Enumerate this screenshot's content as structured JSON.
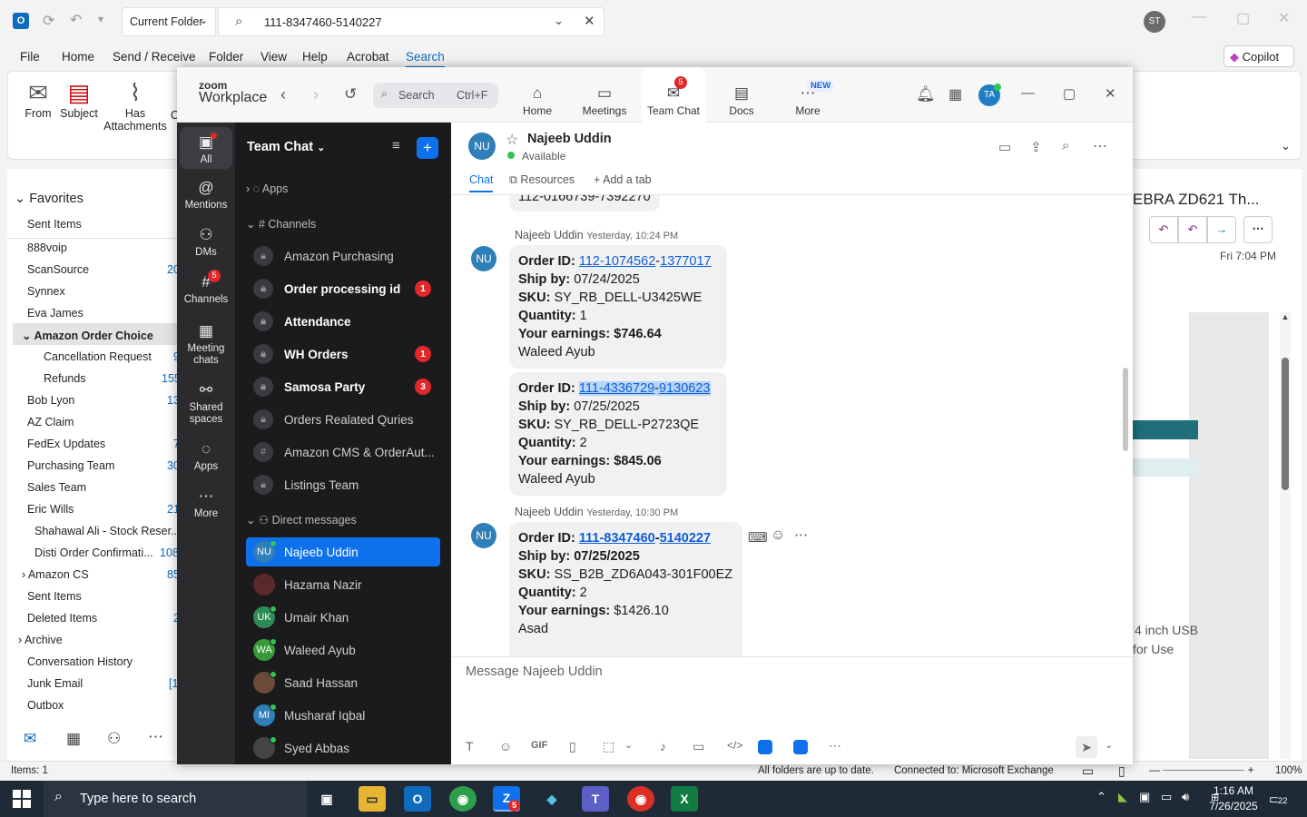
{
  "outlook": {
    "scope": "Current Folder",
    "search_value": "111-8347460-5140227",
    "user_initials": "ST",
    "tabs": [
      "File",
      "Home",
      "Send / Receive",
      "Folder",
      "View",
      "Help",
      "Acrobat",
      "Search"
    ],
    "copilot": "Copilot",
    "ribbon": {
      "from": "From",
      "subject": "Subject",
      "has_attach": "Has",
      "has_attach2": "Attachments",
      "cut": "C"
    },
    "favorites_label": "Favorites",
    "folders": [
      {
        "name": "Sent Items",
        "count": ""
      },
      {
        "name": "888voip",
        "count": ""
      },
      {
        "name": "ScanSource",
        "count": "20"
      },
      {
        "name": "Synnex",
        "count": ""
      },
      {
        "name": "Eva James",
        "count": ""
      },
      {
        "name": "Amazon Order Choice",
        "count": ""
      },
      {
        "name": "Cancellation Request",
        "count": "9"
      },
      {
        "name": "Refunds",
        "count": "155"
      },
      {
        "name": "Bob Lyon",
        "count": "13"
      },
      {
        "name": "AZ Claim",
        "count": ""
      },
      {
        "name": "FedEx Updates",
        "count": "7"
      },
      {
        "name": "Purchasing Team",
        "count": "30"
      },
      {
        "name": "Sales Team",
        "count": ""
      },
      {
        "name": "Eric Wills",
        "count": "21"
      },
      {
        "name": "Shahawal Ali - Stock Reser...",
        "count": ""
      },
      {
        "name": "Disti Order Confirmati...",
        "count": "108"
      },
      {
        "name": "Amazon CS",
        "count": "85"
      },
      {
        "name": "Sent Items",
        "count": ""
      },
      {
        "name": "Deleted Items",
        "count": "2"
      },
      {
        "name": "Archive",
        "count": ""
      },
      {
        "name": "Conversation History",
        "count": ""
      },
      {
        "name": "Junk Email",
        "count": "[1"
      },
      {
        "name": "Outbox",
        "count": ""
      }
    ],
    "reading": {
      "subject": "EBRA ZD621 Th...",
      "date": "Fri 7:04 PM",
      "body1": "4 inch USB",
      "body2": "for Use"
    },
    "status": {
      "items": "Items: 1",
      "sync": "All folders are up to date.",
      "conn": "Connected to: Microsoft Exchange",
      "zoom": "100%"
    }
  },
  "zoom": {
    "logo_small": "zoom",
    "logo": "Workplace",
    "search_placeholder": "Search",
    "search_shortcut": "Ctrl+F",
    "nav": [
      {
        "label": "Home",
        "icon": "⌂"
      },
      {
        "label": "Meetings",
        "icon": "▭"
      },
      {
        "label": "Team Chat",
        "icon": "✉",
        "badge": "5"
      },
      {
        "label": "Docs",
        "icon": "▤"
      },
      {
        "label": "More",
        "icon": "⋯",
        "badge": "NEW"
      }
    ],
    "user_initials": "TA",
    "rail": [
      {
        "label": "All",
        "icon": "▣"
      },
      {
        "label": "Mentions",
        "icon": "@"
      },
      {
        "label": "DMs",
        "icon": "⚇"
      },
      {
        "label": "Channels",
        "icon": "#",
        "badge": "5"
      },
      {
        "label": "Meeting",
        "label2": "chats",
        "icon": "▦"
      },
      {
        "label": "Shared",
        "label2": "spaces",
        "icon": "⚯"
      },
      {
        "label": "Apps",
        "icon": "◌"
      },
      {
        "label": "More",
        "icon": "⋯"
      }
    ],
    "list_title": "Team Chat",
    "apps_label": "Apps",
    "channels_label": "Channels",
    "channels": [
      {
        "name": "Amazon Purchasing",
        "bold": false,
        "badge": ""
      },
      {
        "name": "Order processing id",
        "bold": true,
        "badge": "1"
      },
      {
        "name": "Attendance",
        "bold": true,
        "badge": ""
      },
      {
        "name": "WH Orders",
        "bold": true,
        "badge": "1"
      },
      {
        "name": "Samosa Party",
        "bold": true,
        "badge": "3"
      },
      {
        "name": "Orders Realated Quries",
        "bold": false,
        "badge": ""
      },
      {
        "name": "Amazon CMS & OrderAut...",
        "bold": false,
        "badge": ""
      },
      {
        "name": "Listings Team",
        "bold": false,
        "badge": ""
      }
    ],
    "dm_label": "Direct messages",
    "dms": [
      {
        "initials": "NU",
        "name": "Najeeb Uddin",
        "color": "#2f7fb8"
      },
      {
        "initials": "",
        "name": "Hazama Nazir",
        "color": "#5a2a2a"
      },
      {
        "initials": "UK",
        "name": "Umair Khan",
        "color": "#2e8b57"
      },
      {
        "initials": "WA",
        "name": "Waleed Ayub",
        "color": "#3a9a3a"
      },
      {
        "initials": "",
        "name": "Saad Hassan",
        "color": "#6b4a3a"
      },
      {
        "initials": "MI",
        "name": "Musharaf Iqbal",
        "color": "#2f7fb8"
      },
      {
        "initials": "",
        "name": "Syed Abbas",
        "color": "#444"
      }
    ],
    "chat": {
      "contact_initials": "NU",
      "contact_name": "Najeeb Uddin",
      "status": "Available",
      "tab_chat": "Chat",
      "tab_resources": "Resources",
      "tab_add": "Add a tab",
      "prev_tail": "112-0166739-7392270",
      "msg1_sender": "Najeeb Uddin",
      "msg1_time": "Yesterday, 10:24 PM",
      "msg2_sender": "Najeeb Uddin",
      "msg2_time": "Yesterday, 10:30 PM",
      "lbl_order": "Order ID:",
      "lbl_ship": "Ship by:",
      "lbl_sku": "SKU:",
      "lbl_qty": "Quantity:",
      "lbl_earn": "Your earnings:",
      "orders": [
        {
          "id_a": "112-1074562",
          "id_b": "1377017",
          "ship": "07/24/2025",
          "sku": "SY_RB_DELL-U3425WE",
          "qty": "1",
          "earn": "$746.64",
          "name": "Waleed Ayub"
        },
        {
          "id_a": "111-4336729",
          "id_b": "9130623",
          "ship": "07/25/2025",
          "sku": "SY_RB_DELL-P2723QE",
          "qty": "2",
          "earn": "$845.06",
          "name": "Waleed Ayub"
        },
        {
          "id_a": "111-8347460",
          "id_b": "5140227",
          "ship": "07/25/2025",
          "sku": "SS_B2B_ZD6A043-301F00EZ",
          "qty": "2",
          "earn": "$1426.10",
          "name": "Asad"
        }
      ],
      "compose_placeholder": "Message Najeeb Uddin",
      "gif": "GIF"
    }
  },
  "taskbar": {
    "search_placeholder": "Type here to search",
    "time": "1:16 AM",
    "date": "7/26/2025",
    "notif": "22",
    "zoom_badge": "5"
  }
}
